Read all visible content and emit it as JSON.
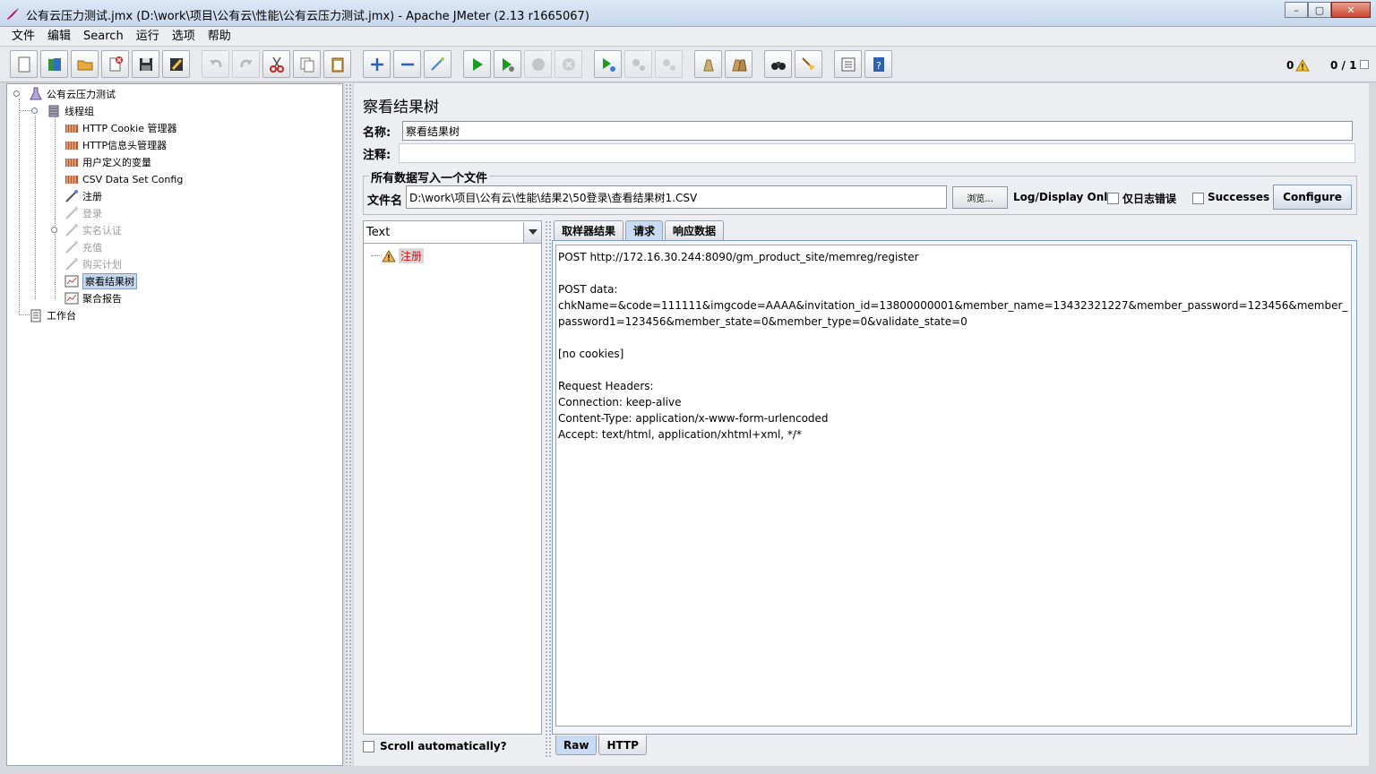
{
  "window": {
    "title": "公有云压力测试.jmx (D:\\work\\项目\\公有云\\性能\\公有云压力测试.jmx) - Apache JMeter (2.13 r1665067)",
    "minimize": "–",
    "maximize": "▢",
    "close": "✕"
  },
  "menu": {
    "items": [
      "文件",
      "编辑",
      "Search",
      "运行",
      "选项",
      "帮助"
    ]
  },
  "toolbar": {
    "warning_count": "0",
    "thread_count": "0 / 1"
  },
  "tree": {
    "items": [
      {
        "label": "公有云压力测试",
        "icon": "testplan-icon"
      },
      {
        "label": "线程组",
        "icon": "threadgroup-icon"
      },
      {
        "label": "HTTP Cookie 管理器",
        "icon": "config-icon"
      },
      {
        "label": "HTTP信息头管理器",
        "icon": "config-icon"
      },
      {
        "label": "用户定义的变量",
        "icon": "config-icon"
      },
      {
        "label": "CSV Data Set Config",
        "icon": "config-icon"
      },
      {
        "label": "注册",
        "icon": "sampler-icon"
      },
      {
        "label": "登录",
        "icon": "sampler-icon"
      },
      {
        "label": "实名认证",
        "icon": "sampler-icon"
      },
      {
        "label": "充值",
        "icon": "sampler-icon"
      },
      {
        "label": "购买计划",
        "icon": "sampler-icon"
      },
      {
        "label": "察看结果树",
        "icon": "listener-icon"
      },
      {
        "label": "聚合报告",
        "icon": "listener-icon"
      },
      {
        "label": "工作台",
        "icon": "workbench-icon"
      }
    ]
  },
  "panel": {
    "title": "察看结果树",
    "name_label": "名称:",
    "name_value": "察看结果树",
    "comment_label": "注释:",
    "comment_value": "",
    "file_group_title": "所有数据写入一个文件",
    "filename_label": "文件名",
    "filename_value": "D:\\work\\项目\\公有云\\性能\\结果2\\50登录\\查看结果树1.CSV",
    "browse_label": "浏览...",
    "log_display_label": "Log/Display Only:",
    "errors_only_label": "仅日志错误",
    "successes_label": "Successes",
    "configure_label": "Configure"
  },
  "results": {
    "renderer": "Text",
    "sample_label": "注册",
    "scroll_auto_label": "Scroll automatically?",
    "tabs": [
      "取样器结果",
      "请求",
      "响应数据"
    ],
    "active_tab": "请求",
    "subtabs": [
      "Raw",
      "HTTP"
    ],
    "active_subtab": "Raw",
    "content_lines": [
      "POST http://172.16.30.244:8090/gm_product_site/memreg/register",
      "",
      "POST data:",
      "chkName=&code=111111&imgcode=AAAA&invitation_id=13800000001&member_name=13432321227&member_password=123456&member_password1=123456&member_state=0&member_type=0&validate_state=0",
      "",
      "[no cookies]",
      "",
      "Request Headers:",
      "Connection: keep-alive",
      "Content-Type: application/x-www-form-urlencoded",
      "Accept: text/html, application/xhtml+xml, */*"
    ]
  },
  "colors": {
    "selection": "#c6d7ee",
    "error_text": "#d01010",
    "run_green": "#1e9a1e"
  }
}
